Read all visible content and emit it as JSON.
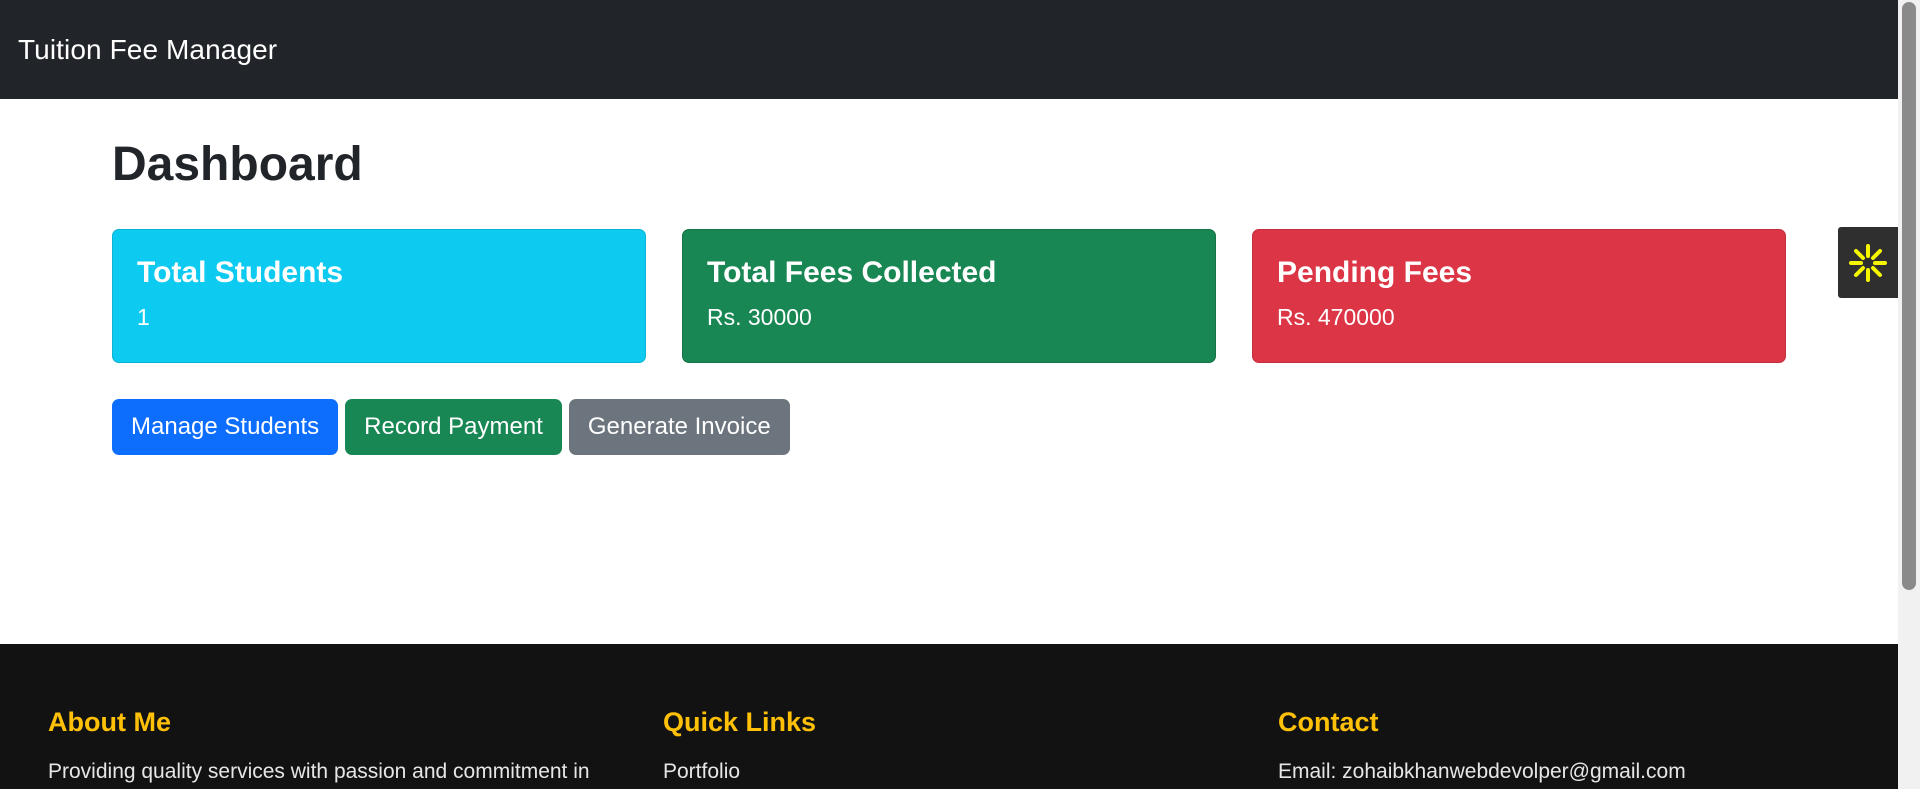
{
  "navbar": {
    "brand": "Tuition Fee Manager"
  },
  "page": {
    "title": "Dashboard"
  },
  "stats": [
    {
      "title": "Total Students",
      "value": "1",
      "color": "#0dcaf0"
    },
    {
      "title": "Total Fees Collected",
      "value": "Rs. 30000",
      "color": "#198754"
    },
    {
      "title": "Pending Fees",
      "value": "Rs. 470000",
      "color": "#dc3545"
    }
  ],
  "actions": {
    "manage_students": "Manage Students",
    "record_payment": "Record Payment",
    "generate_invoice": "Generate Invoice"
  },
  "widget": {
    "icon": "sparkle-icon",
    "icon_color": "#f5f500"
  },
  "footer": {
    "about": {
      "heading": "About Me",
      "text": "Providing quality services with passion and commitment in"
    },
    "links": {
      "heading": "Quick Links",
      "portfolio": "Portfolio"
    },
    "contact": {
      "heading": "Contact",
      "email": "Email: zohaibkhanwebdevolper@gmail.com"
    },
    "heading_color": "#ffc107"
  }
}
